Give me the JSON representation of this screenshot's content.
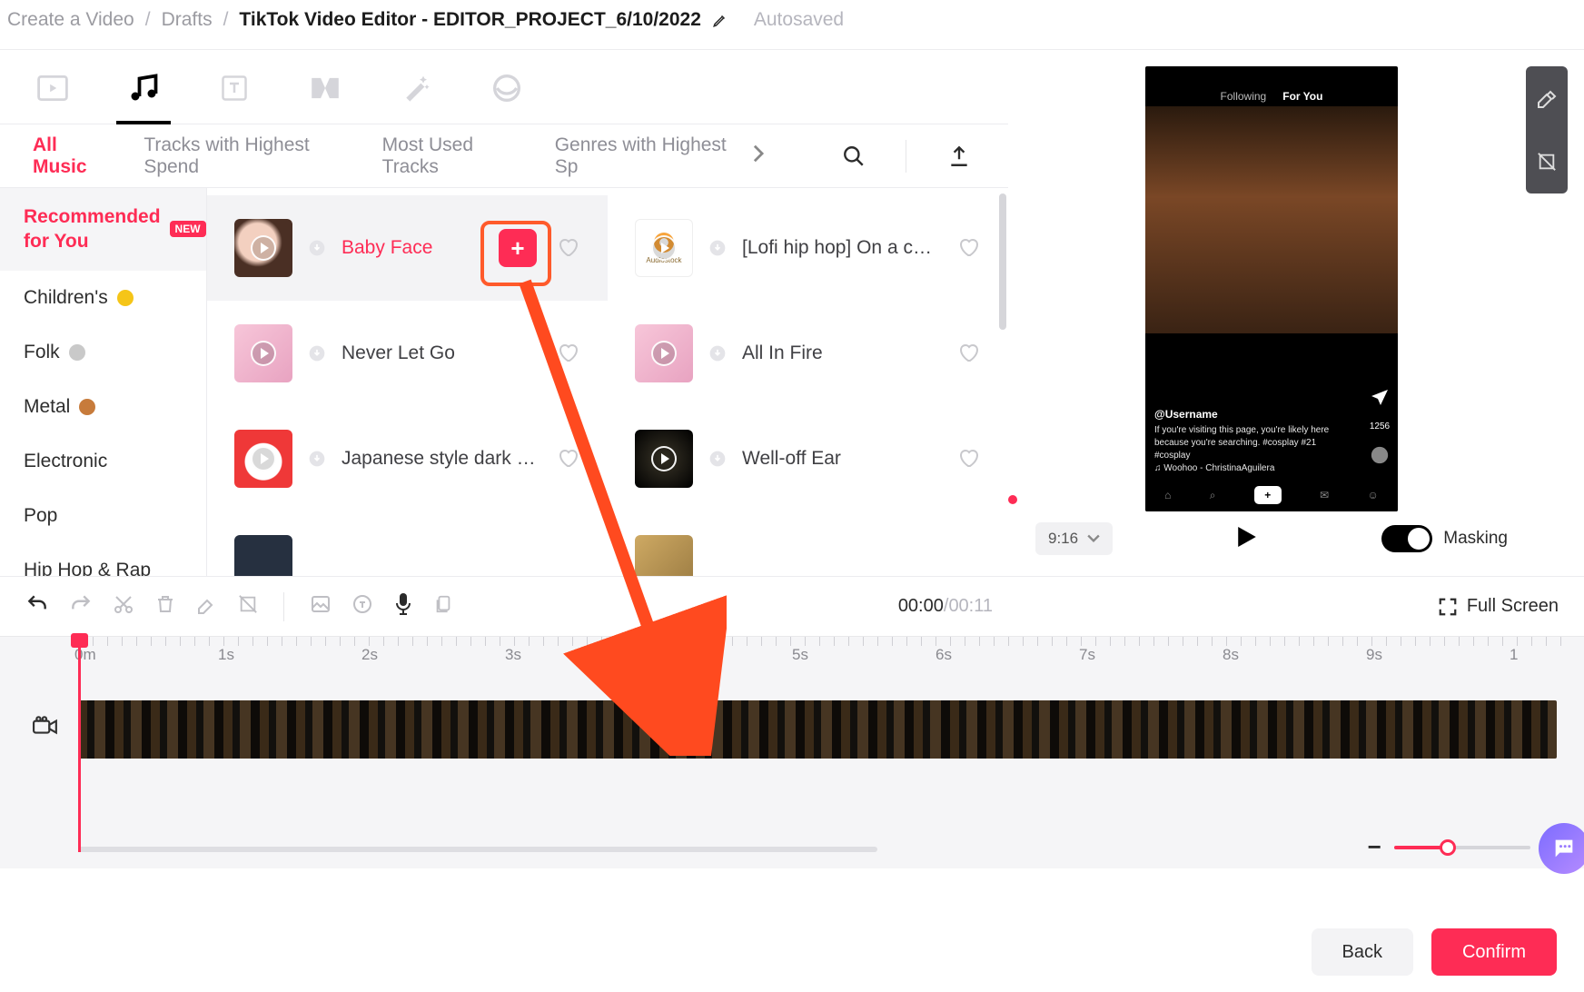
{
  "breadcrumb": {
    "root": "Create a Video",
    "drafts": "Drafts",
    "title": "TikTok Video Editor - EDITOR_PROJECT_6/10/2022",
    "autosaved": "Autosaved"
  },
  "music_tabs": {
    "all": "All Music",
    "highest_spend": "Tracks with Highest Spend",
    "most_used": "Most Used Tracks",
    "genres_spend": "Genres with Highest Sp"
  },
  "genres": {
    "recommended": "Recommended for You",
    "childrens": "Children's",
    "folk": "Folk",
    "metal": "Metal",
    "electronic": "Electronic",
    "pop": "Pop",
    "hiphop": "Hip Hop & Rap",
    "new_label": "NEW"
  },
  "tracks": {
    "baby_face": "Baby Face",
    "lofi": "[Lofi hip hop] On a c…",
    "never_let_go": "Never Let Go",
    "all_in_fire": "All In Fire",
    "jp_dark": "Japanese style dark …",
    "well_off_ear": "Well-off Ear"
  },
  "preview": {
    "following": "Following",
    "for_you": "For You",
    "username": "@Username",
    "caption": "If you're visiting this page, you're likely here because you're searching. #cosplay #21 #cosplay",
    "music_line": "♫ Woohoo - ChristinaAguilera",
    "share_count": "1256",
    "ratio": "9:16",
    "masking": "Masking"
  },
  "timeline": {
    "current": "00:00",
    "duration": "00:11",
    "full_screen": "Full Screen",
    "labels": [
      "0m",
      "1s",
      "2s",
      "3s",
      "5s",
      "6s",
      "7s",
      "8s",
      "9s",
      "1"
    ]
  },
  "footer": {
    "back": "Back",
    "confirm": "Confirm"
  }
}
